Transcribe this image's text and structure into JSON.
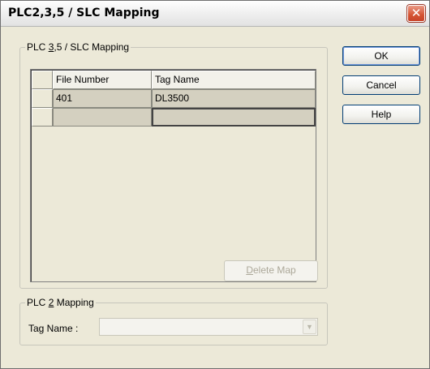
{
  "window": {
    "title": "PLC2,3,5 / SLC Mapping",
    "close_glyph": "✕"
  },
  "mapping_group": {
    "label_pre": "PLC ",
    "label_mnemonic": "3",
    "label_post": ",5 / SLC Mapping",
    "columns": [
      "File Number",
      "Tag Name"
    ],
    "rows": [
      {
        "file_number": "401",
        "tag_name": "DL3500"
      },
      {
        "file_number": "",
        "tag_name": ""
      }
    ],
    "delete_button": {
      "mnemonic": "D",
      "rest": "elete Map"
    }
  },
  "plc2_group": {
    "label_pre": "PLC ",
    "label_mnemonic": "2",
    "label_post": " Mapping",
    "tag_name_label": "Tag Name :",
    "tag_name_value": "",
    "dropdown_glyph": "▼"
  },
  "buttons": {
    "ok": "OK",
    "cancel": "Cancel",
    "help": "Help"
  },
  "colors": {
    "dialog_background": "#ece9d8",
    "close_button": "#d45433",
    "button_border": "#003c74"
  }
}
